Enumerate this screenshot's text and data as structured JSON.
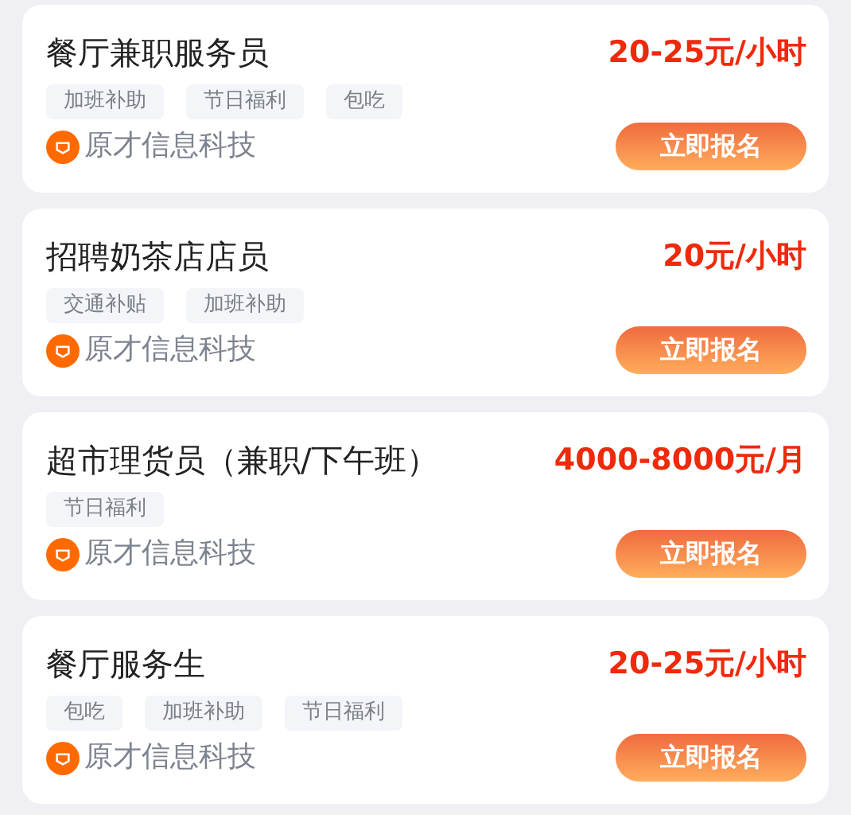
{
  "jobs": [
    {
      "title": "餐厅兼职服务员",
      "salary": "20-25元/小时",
      "tags": [
        "加班补助",
        "节日福利",
        "包吃"
      ],
      "company": "原才信息科技",
      "button": "立即报名"
    },
    {
      "title": "招聘奶茶店店员",
      "salary": "20元/小时",
      "tags": [
        "交通补贴",
        "加班补助"
      ],
      "company": "原才信息科技",
      "button": "立即报名"
    },
    {
      "title": "超市理货员（兼职/下午班）",
      "salary": "4000-8000元/月",
      "tags": [
        "节日福利"
      ],
      "company": "原才信息科技",
      "button": "立即报名"
    },
    {
      "title": "餐厅服务生",
      "salary": "20-25元/小时",
      "tags": [
        "包吃",
        "加班补助",
        "节日福利"
      ],
      "company": "原才信息科技",
      "button": "立即报名"
    }
  ]
}
